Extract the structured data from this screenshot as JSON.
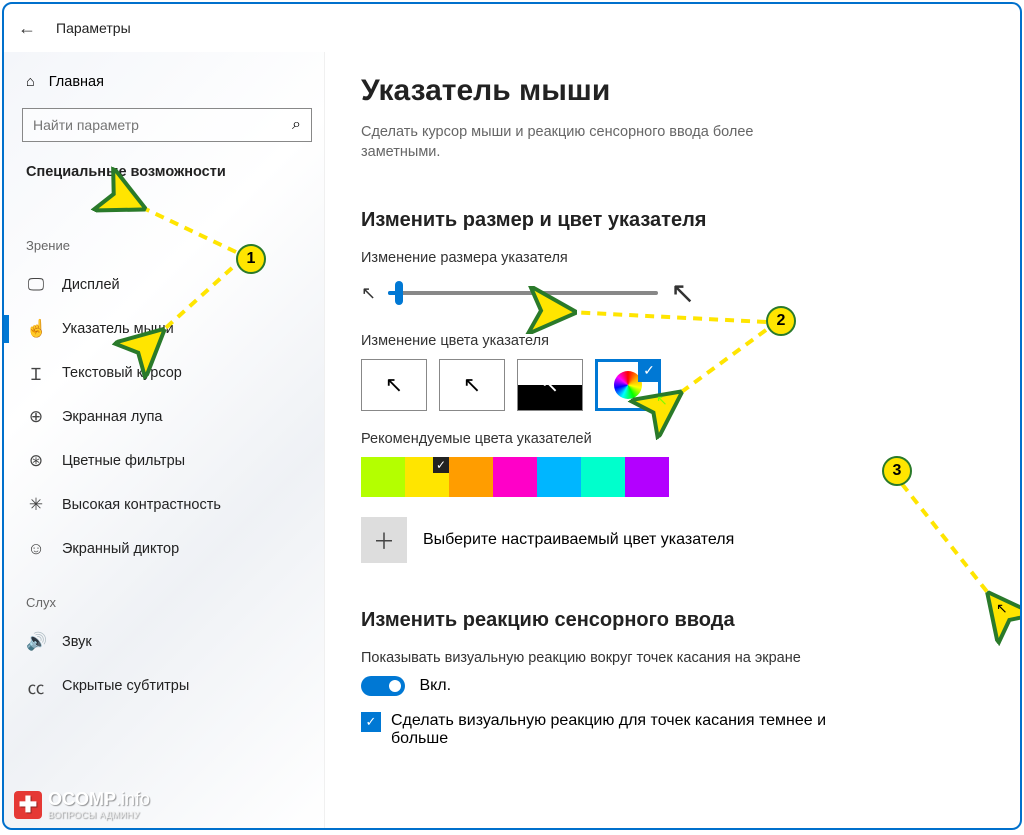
{
  "header": {
    "title": "Параметры"
  },
  "sidebar": {
    "home": "Главная",
    "search_placeholder": "Найти параметр",
    "section": "Специальные возможности",
    "group_vision": "Зрение",
    "group_hearing": "Слух",
    "items_vision": [
      {
        "icon": "display-icon",
        "label": "Дисплей"
      },
      {
        "icon": "pointer-icon",
        "label": "Указатель мыши",
        "active": true
      },
      {
        "icon": "text-cursor-icon",
        "label": "Текстовый курсор"
      },
      {
        "icon": "magnifier-icon",
        "label": "Экранная лупа"
      },
      {
        "icon": "color-filters-icon",
        "label": "Цветные фильтры"
      },
      {
        "icon": "contrast-icon",
        "label": "Высокая контрастность"
      },
      {
        "icon": "narrator-icon",
        "label": "Экранный диктор"
      }
    ],
    "items_hearing": [
      {
        "icon": "audio-icon",
        "label": "Звук"
      },
      {
        "icon": "cc-icon",
        "label": "Скрытые субтитры"
      }
    ]
  },
  "main": {
    "title": "Указатель мыши",
    "desc": "Сделать курсор мыши и реакцию сенсорного ввода более заметными.",
    "section1": "Изменить размер и цвет указателя",
    "slider_label": "Изменение размера указателя",
    "color_label": "Изменение цвета указателя",
    "recommended_label": "Рекомендуемые цвета указателей",
    "custom_label": "Выберите настраиваемый цвет указателя",
    "section2": "Изменить реакцию сенсорного ввода",
    "touch_desc": "Показывать визуальную реакцию вокруг точек касания на экране",
    "toggle_state": "Вкл.",
    "checkbox_label": "Сделать визуальную реакцию для точек касания темнее и больше",
    "swatches": [
      "#b4ff00",
      "#ffe500",
      "#ff9d00",
      "#ff00c8",
      "#00b6ff",
      "#00ffcc",
      "#b300ff"
    ],
    "swatch_selected_index": 1
  },
  "annotations": {
    "b1": "1",
    "b2": "2",
    "b3": "3"
  },
  "logo": {
    "brand": "OCOMP",
    "tld": ".info",
    "sub": "ВОПРОСЫ АДМИНУ"
  }
}
